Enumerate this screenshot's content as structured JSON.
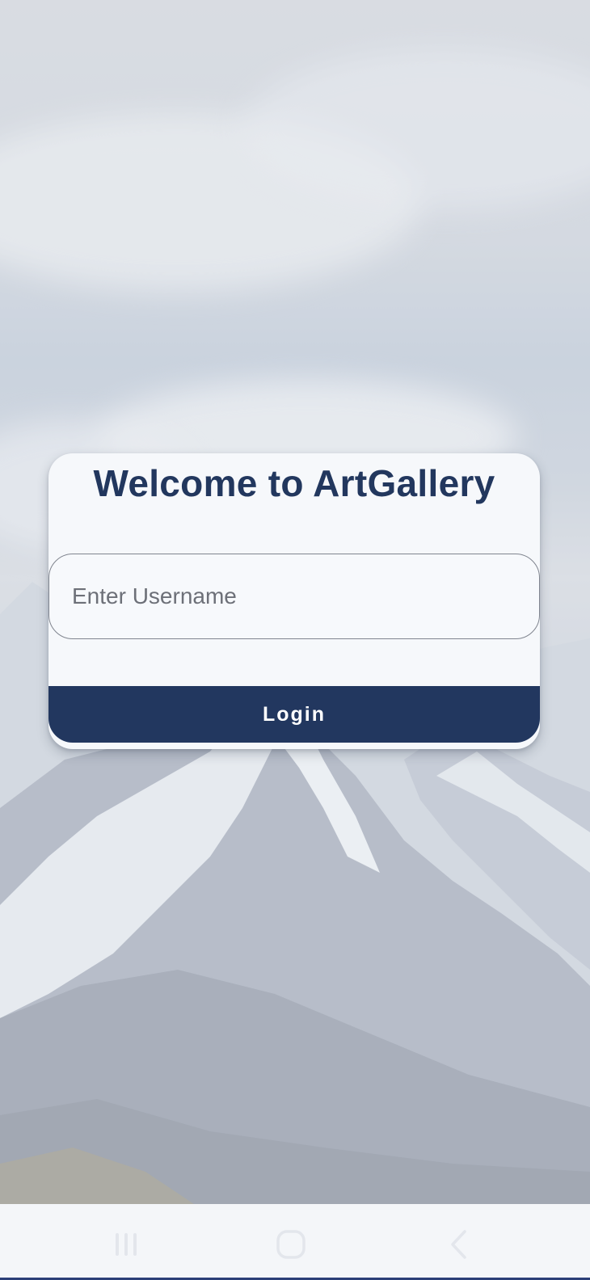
{
  "login_card": {
    "title": "Welcome to ArtGallery",
    "username_placeholder": "Enter Username",
    "username_value": "",
    "login_label": "Login"
  },
  "navigation_bar": {
    "buttons": [
      "recent-apps-icon",
      "home-icon",
      "back-icon"
    ]
  },
  "colors": {
    "brand_navy": "#22375f",
    "card_background": "#f6f8fb",
    "field_border": "#80858f"
  }
}
